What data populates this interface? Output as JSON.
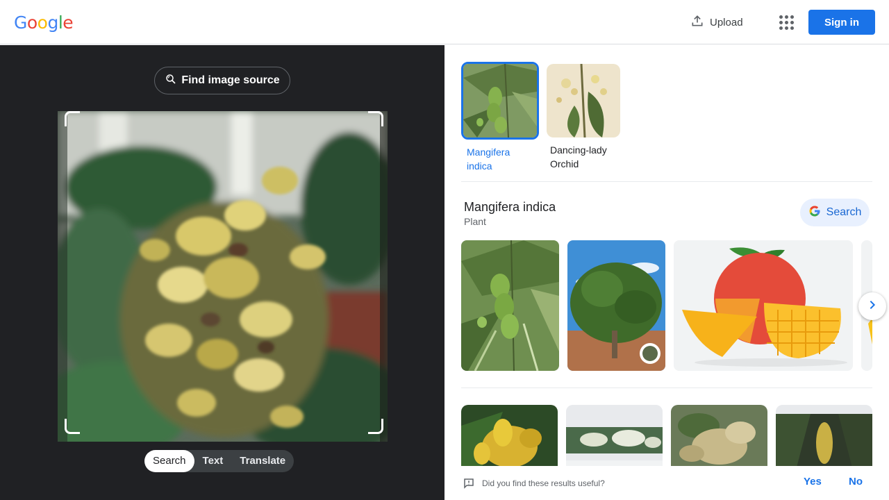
{
  "header": {
    "logo_letters": [
      {
        "ch": "G",
        "color": "#4285f4"
      },
      {
        "ch": "o",
        "color": "#ea4335"
      },
      {
        "ch": "o",
        "color": "#fbbc05"
      },
      {
        "ch": "g",
        "color": "#4285f4"
      },
      {
        "ch": "l",
        "color": "#34a853"
      },
      {
        "ch": "e",
        "color": "#ea4335"
      }
    ],
    "upload_label": "Upload",
    "upload_icon": "upload-icon",
    "apps_icon": "apps-grid-icon",
    "signin_label": "Sign in"
  },
  "left_panel": {
    "find_source_label": "Find image source",
    "find_source_icon": "lens-search-icon",
    "tabs": [
      {
        "label": "Search",
        "active": true
      },
      {
        "label": "Text",
        "active": false
      },
      {
        "label": "Translate",
        "active": false
      }
    ]
  },
  "matches": [
    {
      "label": "Mangifera indica",
      "selected": true
    },
    {
      "label": "Dancing-lady Orchid",
      "selected": false
    }
  ],
  "entity": {
    "title": "Mangifera indica",
    "subtitle": "Plant",
    "search_label": "Search"
  },
  "feedback": {
    "question": "Did you find these results useful?",
    "yes": "Yes",
    "no": "No",
    "icon": "feedback-icon"
  },
  "colors": {
    "accent": "#1a73e8",
    "dark_panel": "#202124"
  }
}
